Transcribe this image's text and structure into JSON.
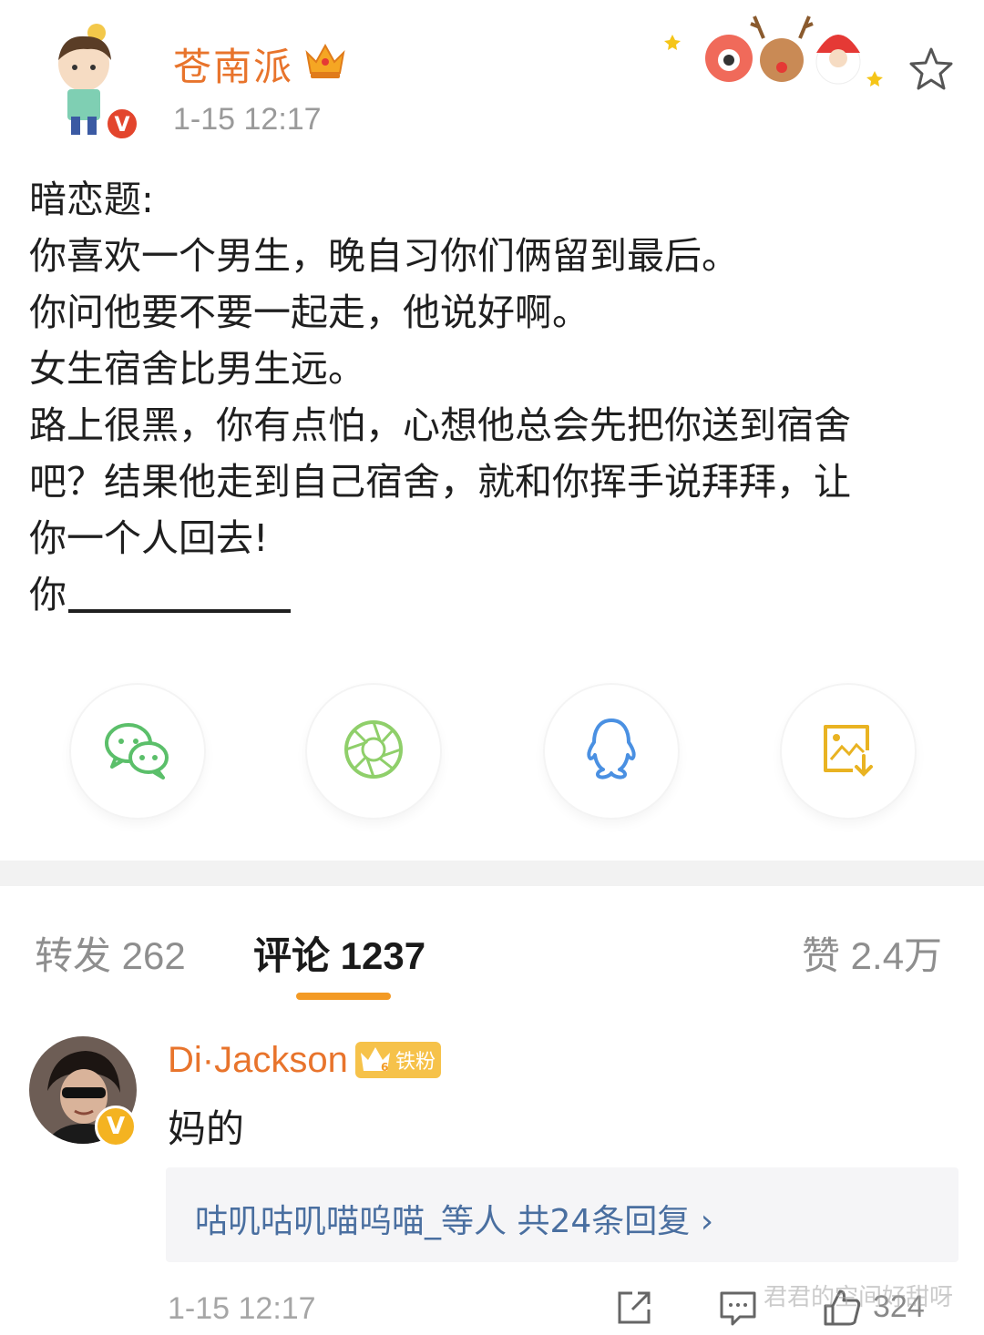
{
  "post": {
    "author": "苍南派",
    "time": "1-15 12:17",
    "lines": [
      "暗恋题:",
      "你喜欢一个男生，晚自习你们俩留到最后。",
      "你问他要不要一起走，他说好啊。",
      "女生宿舍比男生远。",
      "路上很黑，你有点怕，心想他总会先把你送到宿舍",
      "吧？结果他走到自己宿舍，就和你挥手说拜拜，让",
      "你一个人回去!",
      "你"
    ]
  },
  "share": {
    "icons": [
      "wechat-icon",
      "moments-icon",
      "qq-icon",
      "save-image-icon"
    ],
    "colors": {
      "wechat": "#5bbf6a",
      "moments": "#8fcf6a",
      "qq": "#4a90e2",
      "save": "#e9b322"
    }
  },
  "tabs": {
    "repost": "转发 262",
    "comments": "评论 1237",
    "likes": "赞 2.4万"
  },
  "comment": {
    "user": "Di·Jackson",
    "fan_badge": "铁粉",
    "fan_level": "6",
    "text": "妈的",
    "reply_summary": "咕叽咕叽喵呜喵_等人  共24条回复 ›",
    "time": "1-15 12:17",
    "likes": "324"
  },
  "watermark": "君君的空间好甜呀"
}
